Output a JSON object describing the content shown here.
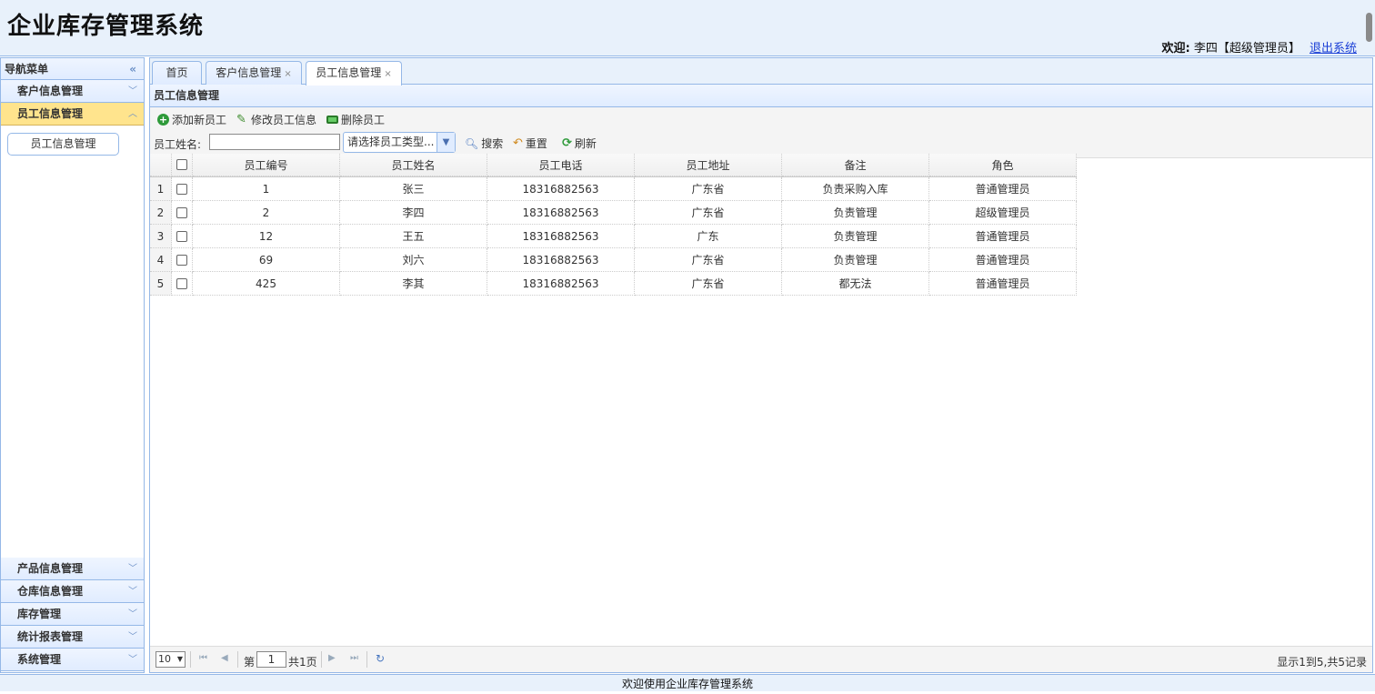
{
  "header": {
    "title": "企业库存管理系统",
    "welcome_label": "欢迎:",
    "user": "李四【超级管理员】",
    "logout": "退出系统"
  },
  "sidebar": {
    "title": "导航菜单",
    "collapse_icon": "double-chevron-left-icon",
    "sections": [
      {
        "label": "客户信息管理"
      },
      {
        "label": "员工信息管理",
        "active": true
      },
      {
        "label": "产品信息管理"
      },
      {
        "label": "仓库信息管理"
      },
      {
        "label": "库存管理"
      },
      {
        "label": "统计报表管理"
      },
      {
        "label": "系统管理"
      }
    ],
    "active_links": [
      "员工信息管理"
    ]
  },
  "tabs": [
    {
      "label": "首页",
      "closable": false
    },
    {
      "label": "客户信息管理",
      "closable": true
    },
    {
      "label": "员工信息管理",
      "closable": true,
      "selected": true
    }
  ],
  "panel": {
    "title": "员工信息管理",
    "toolbar": {
      "add": "添加新员工",
      "edit": "修改员工信息",
      "delete": "删除员工",
      "name_label": "员工姓名:",
      "name_value": "",
      "type_select": "请选择员工类型...",
      "search": "搜索",
      "reset": "重置",
      "refresh": "刷新"
    }
  },
  "grid": {
    "columns": [
      "员工编号",
      "员工姓名",
      "员工电话",
      "员工地址",
      "备注",
      "角色"
    ],
    "rows": [
      [
        "1",
        "张三",
        "18316882563",
        "广东省",
        "负责采购入库",
        "普通管理员"
      ],
      [
        "2",
        "李四",
        "18316882563",
        "广东省",
        "负责管理",
        "超级管理员"
      ],
      [
        "12",
        "王五",
        "18316882563",
        "广东",
        "负责管理",
        "普通管理员"
      ],
      [
        "69",
        "刘六",
        "18316882563",
        "广东省",
        "负责管理",
        "普通管理员"
      ],
      [
        "425",
        "李其",
        "18316882563",
        "广东省",
        "都无法",
        "普通管理员"
      ]
    ]
  },
  "pager": {
    "page_size": "10",
    "page_prefix": "第",
    "page_number": "1",
    "page_suffix": "共1页",
    "info": "显示1到5,共5记录"
  },
  "footer": {
    "text": "欢迎使用企业库存管理系统"
  },
  "colors": {
    "border": "#95b8e7",
    "header_bg": "#e8f1fb",
    "active_section": "#ffe48d"
  }
}
